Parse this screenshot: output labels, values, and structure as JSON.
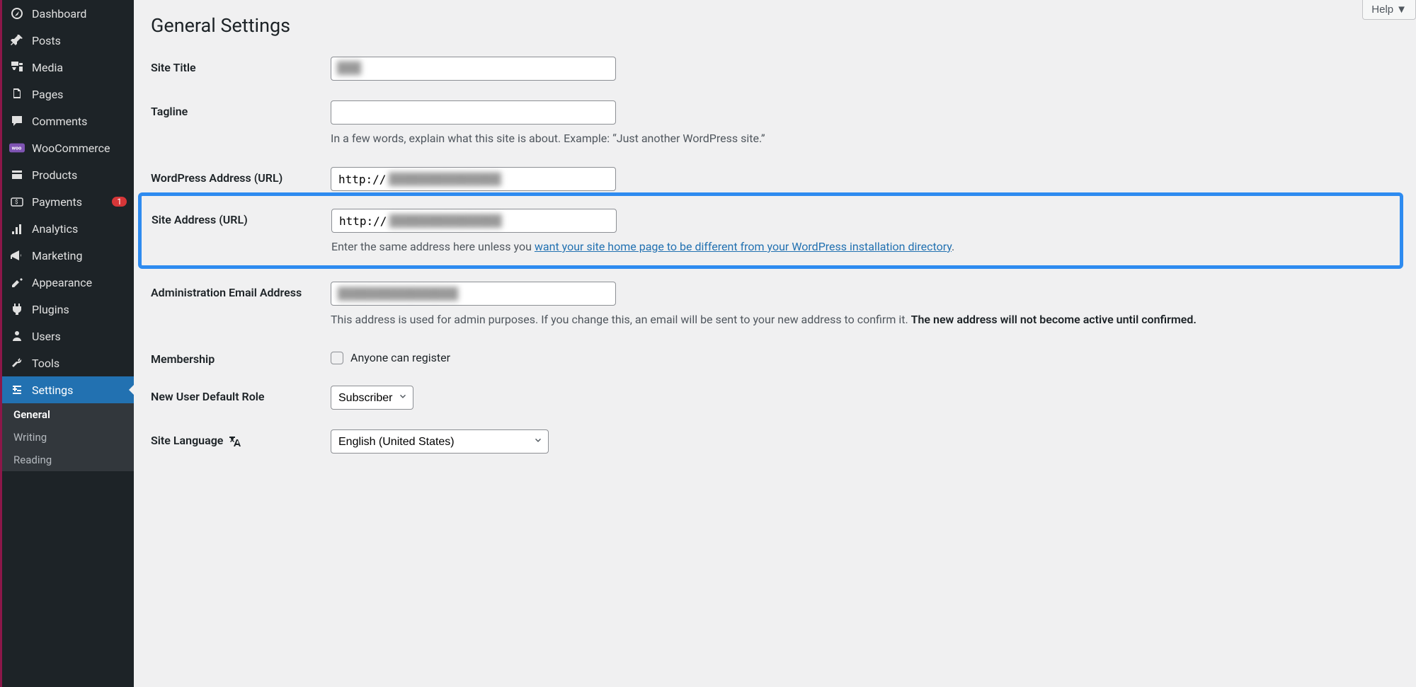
{
  "sidebar": {
    "items": [
      {
        "label": "Dashboard",
        "icon": "dashboard"
      },
      {
        "label": "Posts",
        "icon": "pin"
      },
      {
        "label": "Media",
        "icon": "media"
      },
      {
        "label": "Pages",
        "icon": "pages"
      },
      {
        "label": "Comments",
        "icon": "comments"
      },
      {
        "label": "WooCommerce",
        "icon": "woo"
      },
      {
        "label": "Products",
        "icon": "products"
      },
      {
        "label": "Payments",
        "icon": "payments",
        "badge": "1"
      },
      {
        "label": "Analytics",
        "icon": "analytics"
      },
      {
        "label": "Marketing",
        "icon": "marketing"
      },
      {
        "label": "Appearance",
        "icon": "appearance"
      },
      {
        "label": "Plugins",
        "icon": "plugins"
      },
      {
        "label": "Users",
        "icon": "users"
      },
      {
        "label": "Tools",
        "icon": "tools"
      },
      {
        "label": "Settings",
        "icon": "settings",
        "active": true
      }
    ],
    "submenu": [
      {
        "label": "General",
        "current": true
      },
      {
        "label": "Writing"
      },
      {
        "label": "Reading"
      }
    ]
  },
  "header": {
    "help_label": "Help"
  },
  "page": {
    "title": "General Settings"
  },
  "fields": {
    "site_title": {
      "label": "Site Title",
      "value": "      "
    },
    "tagline": {
      "label": "Tagline",
      "value": "",
      "help": "In a few words, explain what this site is about. Example: “Just another WordPress site.”"
    },
    "wp_url": {
      "label": "WordPress Address (URL)",
      "value": "http://"
    },
    "site_url": {
      "label": "Site Address (URL)",
      "value": "http://",
      "help_pre": "Enter the same address here unless you ",
      "help_link": "want your site home page to be different from your WordPress installation directory",
      "help_post": "."
    },
    "admin_email": {
      "label": "Administration Email Address",
      "value": " ",
      "help_pre": "This address is used for admin purposes. If you change this, an email will be sent to your new address to confirm it. ",
      "help_strong": "The new address will not become active until confirmed."
    },
    "membership": {
      "label": "Membership",
      "checkbox_label": "Anyone can register"
    },
    "role": {
      "label": "New User Default Role",
      "value": "Subscriber"
    },
    "language": {
      "label": "Site Language",
      "value": "English (United States)"
    }
  }
}
